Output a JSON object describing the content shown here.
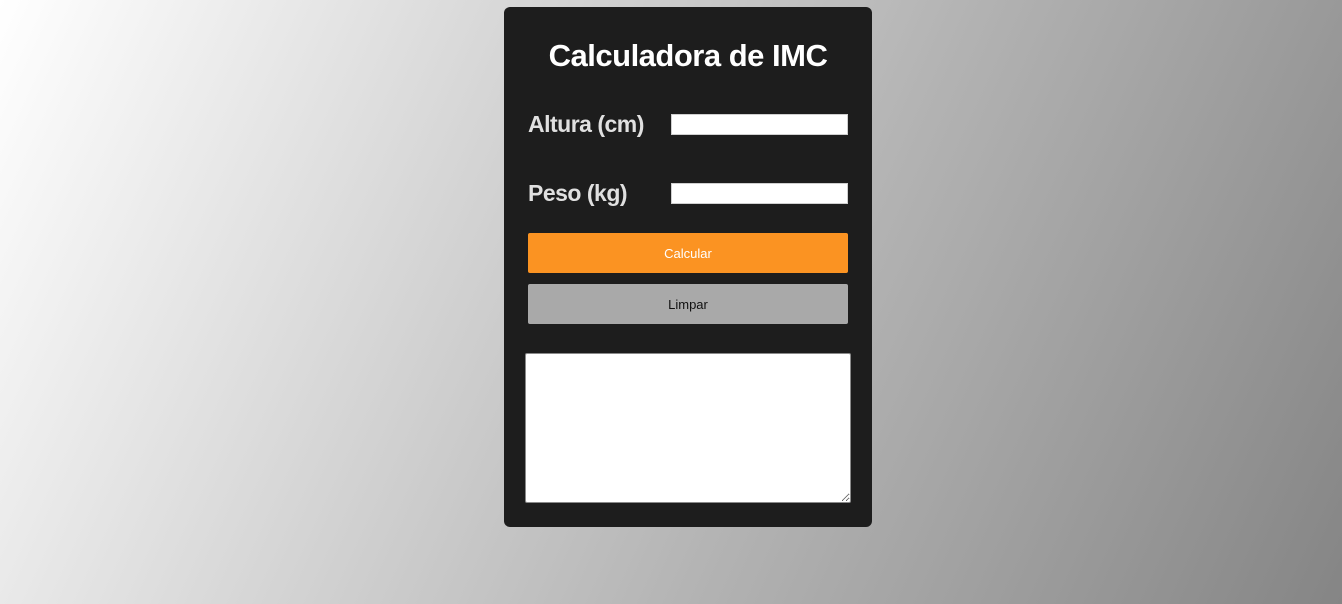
{
  "app": {
    "title": "Calculadora de IMC"
  },
  "form": {
    "altura": {
      "label": "Altura (cm)",
      "value": "",
      "placeholder": ""
    },
    "peso": {
      "label": "Peso (kg)",
      "value": "",
      "placeholder": ""
    }
  },
  "buttons": {
    "calcular_label": "Calcular",
    "limpar_label": "Limpar"
  },
  "result": {
    "value": ""
  },
  "colors": {
    "card_background": "#1d1d1d",
    "calcular_button": "#fb9322",
    "limpar_button": "#a9a9a9",
    "title_text": "#ffffff"
  }
}
